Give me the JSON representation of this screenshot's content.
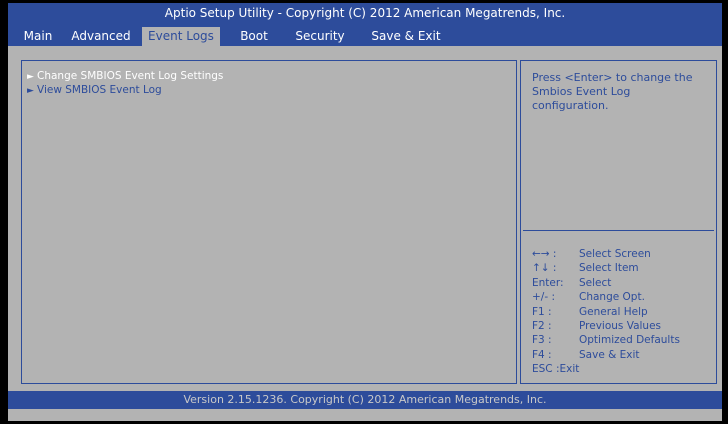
{
  "header": {
    "title": "Aptio Setup Utility - Copyright (C) 2012 American Megatrends, Inc."
  },
  "tabs": [
    {
      "label": "Main"
    },
    {
      "label": "Advanced"
    },
    {
      "label": "Event Logs"
    },
    {
      "label": "Boot"
    },
    {
      "label": "Security"
    },
    {
      "label": "Save & Exit"
    }
  ],
  "active_tab": "Event Logs",
  "menu": {
    "arrow": "►",
    "items": [
      {
        "label": "Change SMBIOS Event Log Settings"
      },
      {
        "label": "View SMBIOS Event Log"
      }
    ]
  },
  "help": {
    "text": "Press <Enter> to change the Smbios Event Log configuration."
  },
  "keys": [
    {
      "key": "←→ :",
      "desc": "Select Screen"
    },
    {
      "key": "↑↓ :",
      "desc": "Select Item"
    },
    {
      "key": "Enter:",
      "desc": "Select"
    },
    {
      "key": "+/- :",
      "desc": "Change Opt."
    },
    {
      "key": "F1 :",
      "desc": "General Help"
    },
    {
      "key": "F2 :",
      "desc": "Previous Values"
    },
    {
      "key": "F3 :",
      "desc": "Optimized Defaults"
    },
    {
      "key": "F4 :",
      "desc": "Save & Exit"
    },
    {
      "key": "ESC :Exit",
      "desc": ""
    }
  ],
  "footer": {
    "text": "Version 2.15.1236. Copyright (C) 2012 American Megatrends, Inc."
  },
  "colors": {
    "accent": "#2d4c9b",
    "background": "#b3b3b3",
    "outer": "#000000"
  }
}
